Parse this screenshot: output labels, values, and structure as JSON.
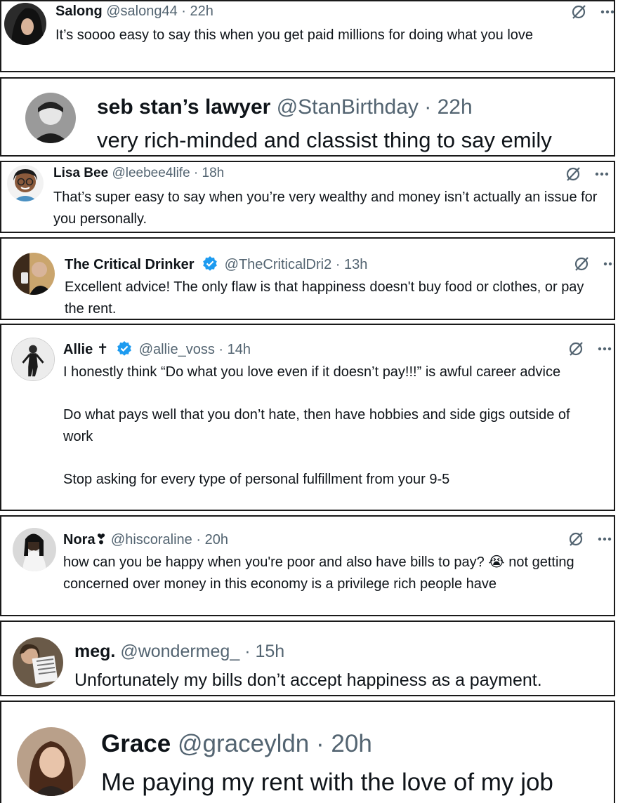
{
  "replies": [
    {
      "name": "Salong",
      "handle": "@salong44",
      "sep": "·",
      "time": "22h",
      "paragraphs": [
        "It’s soooo easy to say this when you get paid millions for doing what you love"
      ],
      "icons": [
        "grok-icon",
        "more-icon"
      ]
    },
    {
      "name": "seb stan’s lawyer",
      "handle": "@StanBirthday",
      "sep": "·",
      "time": "22h",
      "paragraphs": [
        "very rich-minded and classist thing to say emily"
      ]
    },
    {
      "name": "Lisa Bee",
      "handle": "@leebee4life",
      "sep": "·",
      "time": "18h",
      "paragraphs": [
        "That’s super easy to say when you’re very wealthy and money isn’t actually an issue for you personally."
      ],
      "icons": [
        "grok-icon",
        "more-icon"
      ]
    },
    {
      "name": "The Critical Drinker",
      "verified": true,
      "handle": "@TheCriticalDri2",
      "sep": "·",
      "time": "13h",
      "paragraphs": [
        "Excellent advice! The only flaw is that happiness doesn't buy food or clothes, or pay the rent."
      ],
      "icons": [
        "grok-icon",
        "more-icon"
      ]
    },
    {
      "name": "Allie ✝",
      "verified": true,
      "handle": "@allie_voss",
      "sep": "·",
      "time": "14h",
      "paragraphs": [
        "I honestly think “Do what you love even if it doesn’t pay!!!” is awful career advice",
        "Do what pays well that you don’t hate, then have hobbies and side gigs outside of work",
        "Stop asking for every type of personal fulfillment from your 9-5"
      ],
      "icons": [
        "grok-icon",
        "more-icon"
      ]
    },
    {
      "name": "Nora❣",
      "handle": "@hiscoraline",
      "sep": "·",
      "time": "20h",
      "paragraphs": [
        "how can you be happy when you're poor and also have bills to pay? 😭 not getting concerned over money in this economy is a privilege rich people have"
      ],
      "icons": [
        "grok-icon",
        "more-icon"
      ]
    },
    {
      "name": "meg.",
      "handle": "@wondermeg_",
      "sep": "·",
      "time": "15h",
      "paragraphs": [
        "Unfortunately my bills don’t accept happiness as a payment."
      ]
    },
    {
      "name": "Grace",
      "handle": "@graceyldn",
      "sep": "·",
      "time": "20h",
      "paragraphs": [
        "Me paying my rent with the love of my job"
      ]
    }
  ],
  "colors": {
    "name": "#0f1419",
    "handle": "#536471",
    "verified": "#1d9bf0",
    "border": "#1a1a1a"
  }
}
